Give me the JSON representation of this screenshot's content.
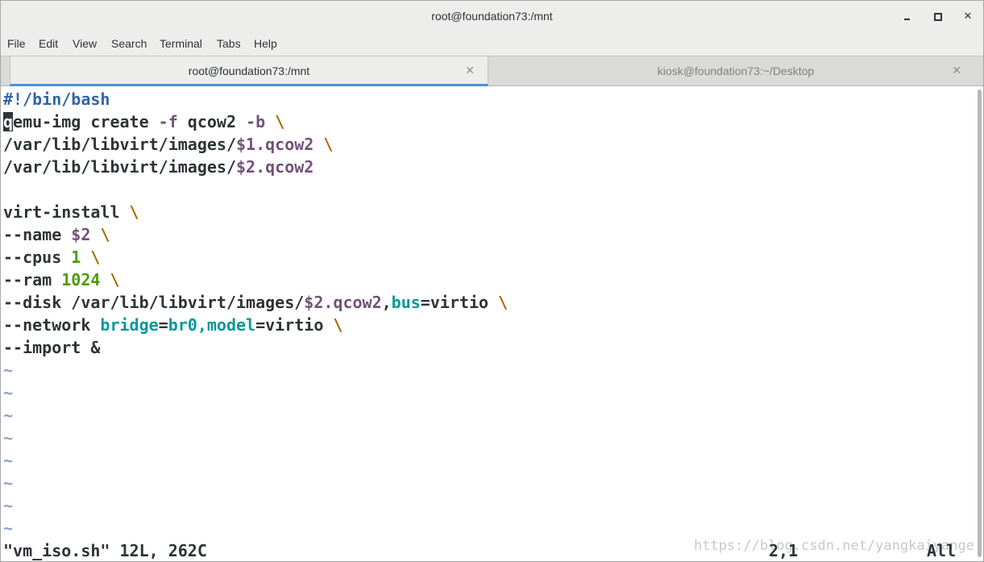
{
  "window": {
    "title": "root@foundation73:/mnt"
  },
  "menubar": {
    "items": [
      "File",
      "Edit",
      "View",
      "Search",
      "Terminal",
      "Tabs",
      "Help"
    ]
  },
  "tabs": [
    {
      "label": "root@foundation73:/mnt",
      "active": true
    },
    {
      "label": "kiosk@foundation73:~/Desktop",
      "active": false
    }
  ],
  "editor": {
    "lines": {
      "l1": {
        "a": "#!/bin/bash"
      },
      "l2": {
        "cursor": "q",
        "a": "emu-img create ",
        "b": "-f",
        "c": " qcow2 ",
        "d": "-b",
        "e": " ",
        "f": "\\"
      },
      "l3": {
        "a": "/var/lib/libvirt/images/",
        "b": "$1.qcow2",
        "c": " ",
        "d": "\\"
      },
      "l4": {
        "a": "/var/lib/libvirt/images/",
        "b": "$2.qcow2"
      },
      "l6": {
        "a": "virt-install ",
        "b": "\\"
      },
      "l7": {
        "a": "--name ",
        "b": "$2",
        "c": " ",
        "d": "\\"
      },
      "l8": {
        "a": "--cpus ",
        "b": "1",
        "c": " ",
        "d": "\\"
      },
      "l9": {
        "a": "--ram ",
        "b": "1024",
        "c": " ",
        "d": "\\"
      },
      "l10": {
        "a": "--disk /var/lib/libvirt/images/",
        "b": "$2.qcow2",
        "c": ",",
        "d": "bus",
        "e": "=virtio ",
        "f": "\\"
      },
      "l11": {
        "a": "--network ",
        "b": "bridge",
        "c": "=",
        "d": "br0,model",
        "e": "=virtio ",
        "f": "\\"
      },
      "l12": {
        "a": "--import &"
      }
    },
    "tilde": "~",
    "status": {
      "file_info": "\"vm_iso.sh\" 12L, 262C",
      "position": "2,1",
      "scroll": "All"
    },
    "watermark": "https://blog.csdn.net/yangkaiyange"
  },
  "colors": {
    "shebang": "#3465a4",
    "variable": "#75507b",
    "continuation": "#a36b00",
    "number": "#4e9a06",
    "keyword": "#06989a",
    "tab_active_underline": "#4a90d9"
  }
}
